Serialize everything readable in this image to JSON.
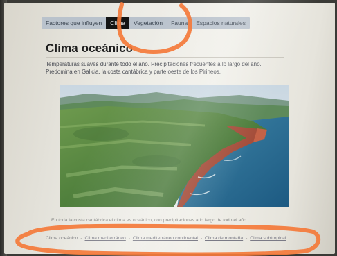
{
  "nav": {
    "tabs": [
      {
        "label": "Factores que influyen",
        "active": false
      },
      {
        "label": "Clima",
        "active": true
      },
      {
        "label": "Vegetación",
        "active": false
      },
      {
        "label": "Fauna",
        "active": false
      },
      {
        "label": "Espacios naturales",
        "active": false
      }
    ]
  },
  "main": {
    "title": "Clima oceánico",
    "description": "Temperaturas suaves durante todo el año. Precipitaciones frecuentes a lo largo del año. Predomina en Galicia, la costa cantábrica y parte oeste de los Pirineos.",
    "caption": "En toda la costa cantábrica el clima es oceánico, con precipitaciones a lo largo de todo el año."
  },
  "footer": {
    "links": [
      {
        "label": "Clima oceánico",
        "current": true
      },
      {
        "label": "Clima mediterráneo",
        "current": false
      },
      {
        "label": "Clima mediterráneo continental",
        "current": false
      },
      {
        "label": "Clima de montaña",
        "current": false
      },
      {
        "label": "Clima subtropical",
        "current": false
      }
    ],
    "separator": "-"
  },
  "colors": {
    "marker": "#f47a3a",
    "active_tab": "#141414",
    "nav_bar": "#b9c2cc"
  }
}
